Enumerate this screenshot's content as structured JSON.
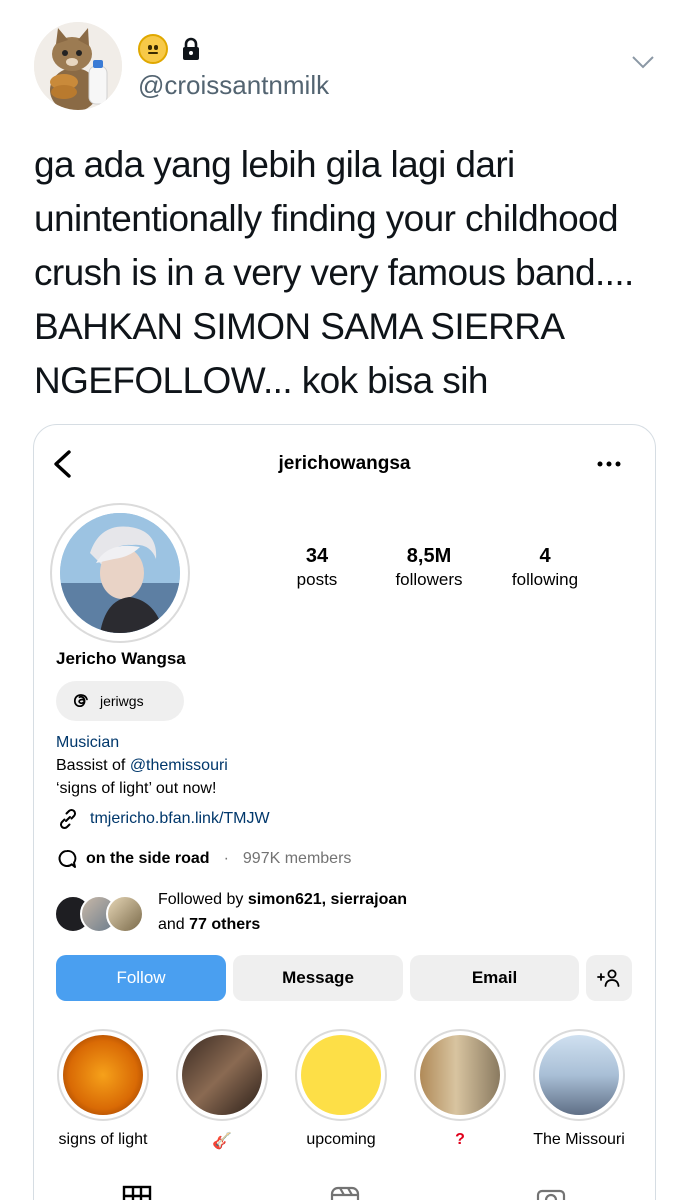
{
  "tweet": {
    "handle": "@croissantnmilk",
    "text_lines": [
      "ga ada yang lebih gila lagi dari",
      "unintentionally finding your childhood",
      "crush is in a very very famous band....",
      "BAHKAN SIMON SAMA SIERRA",
      "NGEFOLLOW... kok bisa sih"
    ]
  },
  "instagram": {
    "username": "jerichowangsa",
    "stats": [
      {
        "value": "34",
        "label": "posts"
      },
      {
        "value": "8,5M",
        "label": "followers"
      },
      {
        "value": "4",
        "label": "following"
      }
    ],
    "full_name": "Jericho Wangsa",
    "threads_handle": "jeriwgs",
    "category": "Musician",
    "bio_prefix": "Bassist of ",
    "bio_mention": "@themissouri",
    "bio_line2": "‘signs of light’ out now!",
    "link": "tmjericho.bfan.link/TMJW",
    "channel_name": "on the side road",
    "channel_dot": "·",
    "channel_members": "997K members",
    "followed_prefix": "Followed by ",
    "followed_names": "simon621, sierrajoan",
    "followed_and": "and ",
    "followed_others": "77 others",
    "buttons": {
      "follow": "Follow",
      "message": "Message",
      "email": "Email"
    },
    "highlights": [
      {
        "label": "signs of light"
      },
      {
        "label": "🎸"
      },
      {
        "label": "upcoming"
      },
      {
        "label": "?"
      },
      {
        "label": "The Missouri"
      }
    ]
  },
  "colors": {
    "follow_button": "#4a9ff0",
    "link_blue": "#00376b",
    "question_red": "#e0001b",
    "upcoming_yellow": "#fddf47"
  }
}
